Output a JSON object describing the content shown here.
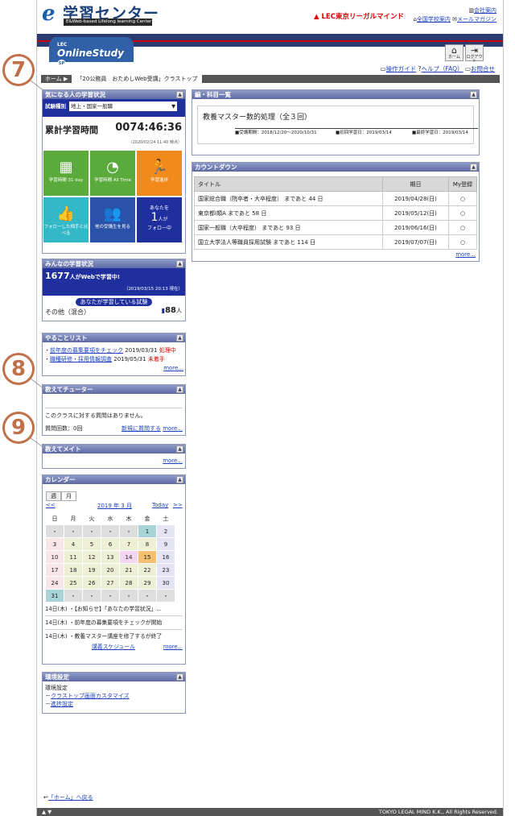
{
  "header": {
    "logo_letter": "e",
    "logo_title": "学習センター",
    "logo_sub": "E&Web-based Lifelong learning Center",
    "lec_brand": "LEC東京リーガルマインド",
    "link_company": "会社案内",
    "link_schools": "全国学校案内",
    "link_mail": "メールマガジン"
  },
  "appbar": {
    "lec_small": "LEC",
    "online_study": "OnlineStudy",
    "sp_badge": "SP",
    "home_btn": "ホーム",
    "logout_btn": "ログアウト",
    "guide": "操作ガイド",
    "help": "ヘルプ（FAQ）",
    "contact": "お問合せ"
  },
  "breadcrumb": {
    "home": "ホーム",
    "current": "「20公務員　おためしWeb受講」クラストップ"
  },
  "callouts": {
    "c7": "7",
    "c8": "8",
    "c9": "9"
  },
  "study": {
    "title": "気になる人の学習状況",
    "exam_label": "試験種別",
    "exam_value": "地上・国家一般職",
    "total_label": "累計学習時間",
    "total_value": "0074:46:36",
    "as_of": "（2020/02/24 11:40 時点）",
    "tiles": [
      {
        "icon": "▦",
        "label": "学習時間 31 day"
      },
      {
        "icon": "◔",
        "label": "学習時間 All Time"
      },
      {
        "icon": "🏃",
        "label": "学習進捗"
      },
      {
        "icon": "👍",
        "label": "フォローした相手と比べる"
      },
      {
        "icon": "👥",
        "label": "他の受講生を見る"
      }
    ],
    "follow_l1": "あなたを",
    "follow_num": "1",
    "follow_unit": "人が",
    "follow_l2": "フォロー中"
  },
  "minna": {
    "title": "みんなの学習状況",
    "count": "1677",
    "count_suffix": "人がWebで学習中!",
    "as_of": "（2019/03/15 20:13 現在）",
    "pill": "あなたが学習している試験",
    "exam": "その他（混合）",
    "num": "88",
    "unit": "人"
  },
  "todo": {
    "title": "やることリスト",
    "items": [
      {
        "text": "前年度の募集要項をチェック",
        "date": "2019/03/31",
        "status": "処理中"
      },
      {
        "text": "職種研修・採用情報調査",
        "date": "2019/05/31",
        "status": "未着手"
      }
    ],
    "more": "more..."
  },
  "tutor": {
    "title": "教えてチューター",
    "empty": "このクラスに対する質問はありません。",
    "count": "質問回数：0回",
    "new_q": "新規に質問する",
    "more": "more..."
  },
  "mate": {
    "title": "教えてメイト",
    "more": "more..."
  },
  "calendar": {
    "title": "カレンダー",
    "tab_week": "週",
    "tab_month": "月",
    "prev": "<<",
    "month": "2019 年 3 月",
    "today": "Today",
    "next": ">>",
    "dows": [
      "日",
      "月",
      "火",
      "水",
      "木",
      "金",
      "土"
    ],
    "events": [
      "14日(木) ・【お知らせ】「あなたの学習状況」...",
      "14日(木) ・前年度の募集要項をチェックが開始",
      "14日(木) ・教養マスター講座を修了するが終了"
    ],
    "schedule": "講義スケジュール",
    "more": "more..."
  },
  "env": {
    "title": "環境設定",
    "heading": "環境設定",
    "links": [
      "クラストップ画面カスタマイズ",
      "進捗設定"
    ]
  },
  "subjects": {
    "title": "編・科目一覧",
    "course": "教養マスター数的処理（全３回）",
    "period": "■受講期間：2018/12/20〜2020/10/31",
    "first": "■初回学習日：2019/03/14",
    "last": "■最終学習日：2019/03/14"
  },
  "countdown": {
    "title": "カウントダウン",
    "cols": [
      "タイトル",
      "期日",
      "My登録"
    ],
    "rows": [
      {
        "t": "国家総合職（院卒者・大卒程度） まであと 44 日",
        "d": "2019/04/28(日)",
        "m": "○"
      },
      {
        "t": "東京都Ⅰ類A まであと 58 日",
        "d": "2019/05/12(日)",
        "m": "○"
      },
      {
        "t": "国家一般職（大卒程度） まであと 93 日",
        "d": "2019/06/16(日)",
        "m": "○"
      },
      {
        "t": "国立大学法人等職員採用試験 まであと 114 日",
        "d": "2019/07/07(日)",
        "m": "○"
      }
    ],
    "more": "more..."
  },
  "footer": {
    "back": "「ホーム」へ戻る",
    "arrows": "▲ ▼",
    "copyright": "TOKYO LEGAL MIND K.K., All Rights Reserved."
  },
  "colors": {
    "panel_header": "#6d79b0",
    "blue_box": "#1f2f9e",
    "tile_green": "#5aaa3c",
    "tile_orange": "#f08a1a",
    "tile_teal": "#33b8c8",
    "tile_blue": "#2a52a8",
    "callout": "#c0714a"
  }
}
